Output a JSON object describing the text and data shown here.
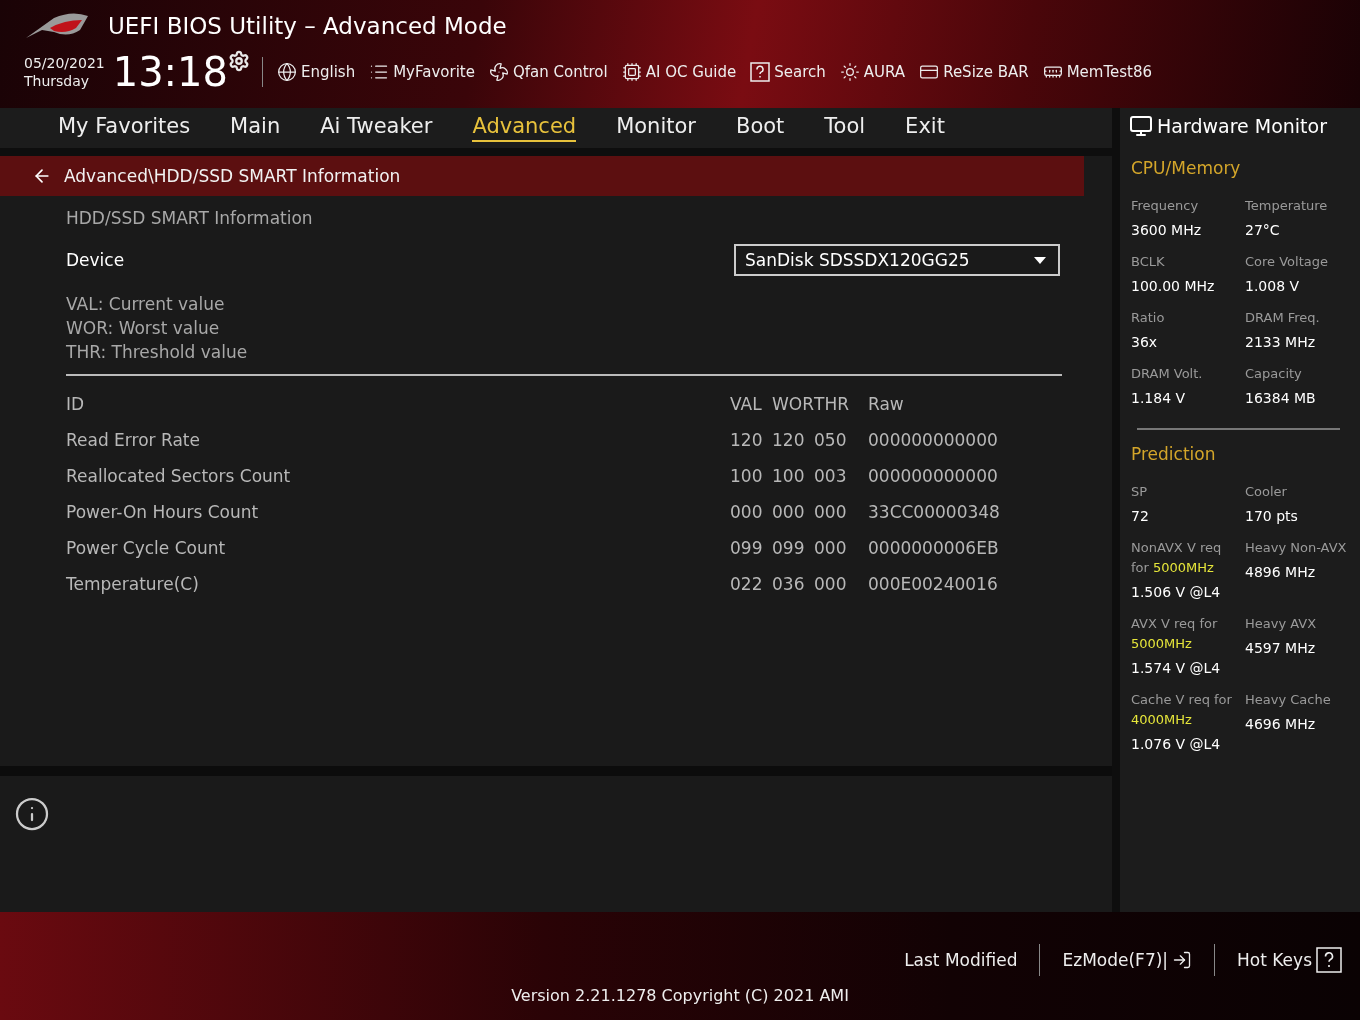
{
  "header": {
    "title": "UEFI BIOS Utility – Advanced Mode",
    "date": "05/20/2021",
    "weekday": "Thursday",
    "time": "13:18",
    "tools": [
      {
        "kind": "globe",
        "label": "English"
      },
      {
        "kind": "list",
        "label": "MyFavorite"
      },
      {
        "kind": "fan",
        "label": "Qfan Control"
      },
      {
        "kind": "chip",
        "label": "AI OC Guide"
      },
      {
        "kind": "search",
        "label": "Search"
      },
      {
        "kind": "light",
        "label": "AURA"
      },
      {
        "kind": "card",
        "label": "ReSize BAR"
      },
      {
        "kind": "memory",
        "label": "MemTest86"
      }
    ]
  },
  "tabs": [
    {
      "label": "My Favorites",
      "selected": false
    },
    {
      "label": "Main",
      "selected": false
    },
    {
      "label": "Ai Tweaker",
      "selected": false
    },
    {
      "label": "Advanced",
      "selected": true
    },
    {
      "label": "Monitor",
      "selected": false
    },
    {
      "label": "Boot",
      "selected": false
    },
    {
      "label": "Tool",
      "selected": false
    },
    {
      "label": "Exit",
      "selected": false
    }
  ],
  "breadcrumb": "Advanced\\HDD/SSD SMART Information",
  "section_title": "HDD/SSD SMART Information",
  "device": {
    "label": "Device",
    "value": "SanDisk SDSSDX120GG25"
  },
  "legend": [
    {
      "key": "VAL:",
      "text": "Current value"
    },
    {
      "key": "WOR:",
      "text": "Worst value"
    },
    {
      "key": "THR:",
      "text": "Threshold value"
    }
  ],
  "table": {
    "columns": [
      "ID",
      "VAL",
      "WOR",
      "THR",
      "Raw"
    ],
    "rows": [
      {
        "name": "Read Error Rate",
        "val": "120",
        "wor": "120",
        "thr": "050",
        "raw": "000000000000"
      },
      {
        "name": "Reallocated Sectors Count",
        "val": "100",
        "wor": "100",
        "thr": "003",
        "raw": "000000000000"
      },
      {
        "name": "Power-On Hours Count",
        "val": "000",
        "wor": "000",
        "thr": "000",
        "raw": "33CC00000348"
      },
      {
        "name": "Power Cycle Count",
        "val": "099",
        "wor": "099",
        "thr": "000",
        "raw": "0000000006EB"
      },
      {
        "name": "Temperature(C)",
        "val": "022",
        "wor": "036",
        "thr": "000",
        "raw": "000E00240016"
      }
    ]
  },
  "hardware_monitor": {
    "title": "Hardware Monitor",
    "sections": [
      {
        "title": "CPU/Memory",
        "items": [
          {
            "label": "Frequency",
            "value": "3600 MHz"
          },
          {
            "label": "Temperature",
            "value": "27°C"
          },
          {
            "label": "BCLK",
            "value": "100.00 MHz"
          },
          {
            "label": "Core Voltage",
            "value": "1.008 V"
          },
          {
            "label": "Ratio",
            "value": "36x"
          },
          {
            "label": "DRAM Freq.",
            "value": "2133 MHz"
          },
          {
            "label": "DRAM Volt.",
            "value": "1.184 V"
          },
          {
            "label": "Capacity",
            "value": "16384 MB"
          }
        ]
      },
      {
        "title": "Prediction",
        "items": [
          {
            "label": "SP",
            "value": "72"
          },
          {
            "label": "Cooler",
            "value": "170 pts"
          },
          {
            "label": "NonAVX V req for **5000MHz**",
            "value": "1.506 V @L4"
          },
          {
            "label": "Heavy Non-AVX",
            "value": "4896 MHz"
          },
          {
            "label": "AVX V req for **5000MHz**",
            "value": "1.574 V @L4"
          },
          {
            "label": "Heavy AVX",
            "value": "4597 MHz"
          },
          {
            "label": "Cache V req for **4000MHz**",
            "value": "1.076 V @L4"
          },
          {
            "label": "Heavy Cache",
            "value": "4696 MHz"
          }
        ]
      }
    ]
  },
  "footer": {
    "actions": [
      {
        "kind": "plain",
        "label": "Last Modified"
      },
      {
        "kind": "exit",
        "label": "EzMode(F7)|"
      },
      {
        "kind": "help",
        "label": "Hot Keys"
      }
    ],
    "version": "Version 2.21.1278 Copyright (C) 2021 AMI"
  }
}
